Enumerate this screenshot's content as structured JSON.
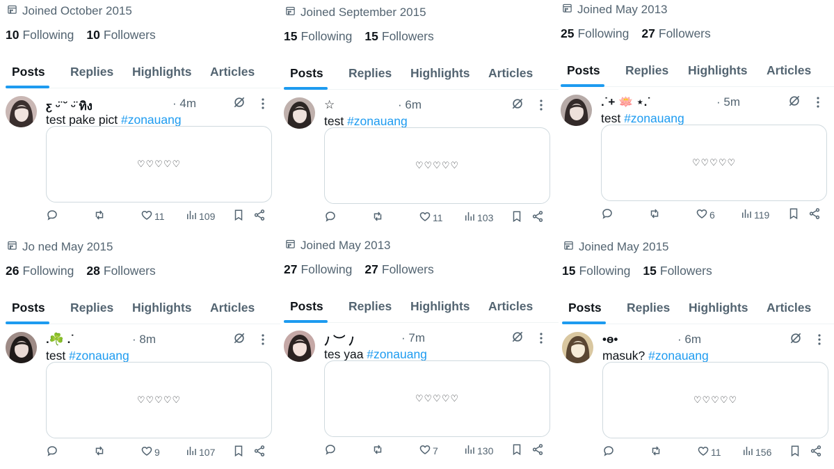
{
  "tabs": [
    "Posts",
    "Replies",
    "Highlights",
    "Articles"
  ],
  "following_label": "Following",
  "followers_label": "Followers",
  "media_hearts": "♡♡♡♡♡",
  "panels": [
    {
      "joined": "Joined October 2015",
      "following": "10",
      "followers": "10",
      "display_name": "ƹ ᵕ̈ ˘ ᵕ̈ ทิง",
      "time": "· 4m",
      "text": "test pake pict ",
      "hashtag": "#zonauang",
      "likes": "11",
      "views": "109"
    },
    {
      "joined": "Joined September 2015",
      "following": "15",
      "followers": "15",
      "display_name": "☆",
      "time": "· 6m",
      "text": "test ",
      "hashtag": "#zonauang",
      "likes": "11",
      "views": "103"
    },
    {
      "joined": "Joined May 2013",
      "following": "25",
      "followers": "27",
      "display_name": ".˙+ 🪷 ⋆.˙",
      "time": "· 5m",
      "text": "test ",
      "hashtag": "#zonauang",
      "likes": "6",
      "views": "119"
    },
    {
      "joined": "Jo ned May 2015",
      "following": "26",
      "followers": "28",
      "display_name": ".☘️ .˙",
      "time": "· 8m",
      "text": "test ",
      "hashtag": "#zonauang",
      "likes": "9",
      "views": "107"
    },
    {
      "joined": "Joined May 2013",
      "following": "27",
      "followers": "27",
      "display_name": "ﾉ ︶ ﾉ",
      "time": "· 7m",
      "text": "tes yaa ",
      "hashtag": "#zonauang",
      "likes": "7",
      "views": "130"
    },
    {
      "joined": "Joined May 2015",
      "following": "15",
      "followers": "15",
      "display_name": "•ɵ•",
      "time": "· 6m",
      "text": "masuk? ",
      "hashtag": "#zonauang",
      "likes": "11",
      "views": "156"
    }
  ],
  "colors": {
    "accent": "#1d9bf0",
    "text": "#0f1419",
    "muted": "#536471",
    "border": "#cfd9de"
  },
  "icons": [
    "calendar-icon",
    "grok-icon",
    "more-icon",
    "reply-icon",
    "repost-icon",
    "like-icon",
    "views-icon",
    "bookmark-icon",
    "share-icon"
  ]
}
